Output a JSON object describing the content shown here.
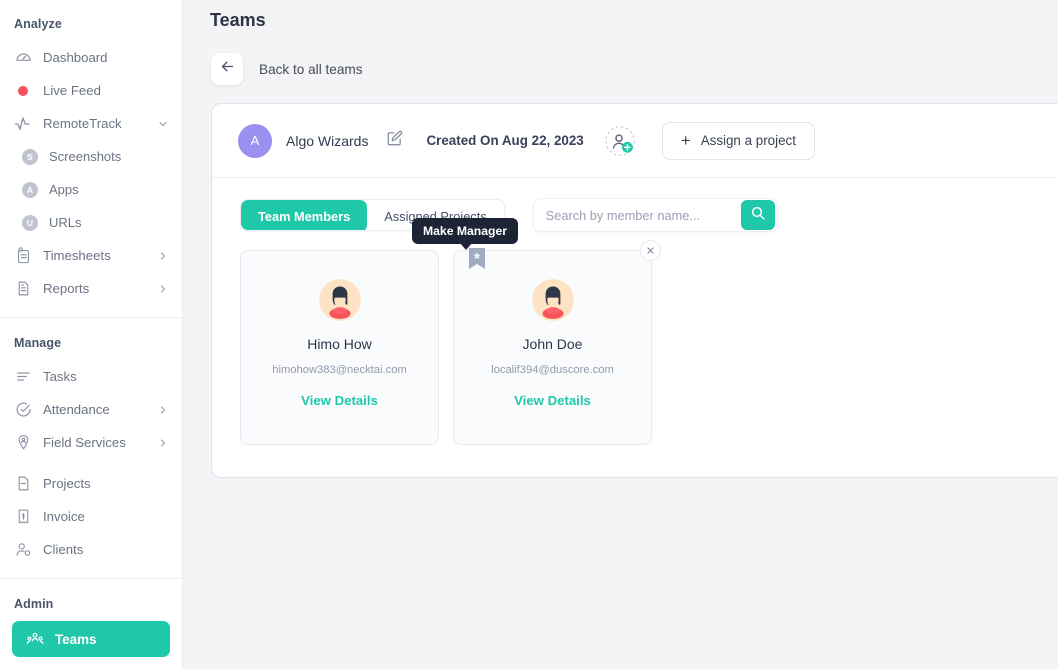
{
  "sidebar": {
    "sections": [
      {
        "label": "Analyze",
        "items": [
          {
            "label": "Dashboard",
            "icon": "gauge-icon",
            "chevron": false
          },
          {
            "label": "Live Feed",
            "icon": "live-dot-icon",
            "chevron": false
          },
          {
            "label": "RemoteTrack",
            "icon": "activity-icon",
            "chevron": true
          },
          {
            "label": "Screenshots",
            "icon": "s-circle-icon",
            "sub": true
          },
          {
            "label": "Apps",
            "icon": "a-circle-icon",
            "sub": true
          },
          {
            "label": "URLs",
            "icon": "u-circle-icon",
            "sub": true
          },
          {
            "label": "Timesheets",
            "icon": "timesheet-icon",
            "chevron": true
          },
          {
            "label": "Reports",
            "icon": "report-icon",
            "chevron": true
          }
        ]
      },
      {
        "label": "Manage",
        "items": [
          {
            "label": "Tasks",
            "icon": "tasks-icon",
            "chevron": false
          },
          {
            "label": "Attendance",
            "icon": "attendance-icon",
            "chevron": true
          },
          {
            "label": "Field Services",
            "icon": "location-person-icon",
            "chevron": true
          },
          {
            "label": "Projects",
            "icon": "projects-icon",
            "chevron": false
          },
          {
            "label": "Invoice",
            "icon": "invoice-icon",
            "chevron": false
          },
          {
            "label": "Clients",
            "icon": "clients-icon",
            "chevron": false
          }
        ]
      },
      {
        "label": "Admin",
        "items": [
          {
            "label": "Teams",
            "icon": "teams-icon",
            "active": true
          }
        ]
      }
    ]
  },
  "header": {
    "page_title": "Teams",
    "back_label": "Back to all teams",
    "back_icon": "arrow-left-icon"
  },
  "team": {
    "avatar_letter": "A",
    "name": "Algo Wizards",
    "edit_icon": "edit-pencil-icon",
    "created_on": "Created On Aug 22, 2023",
    "add_member_icon": "add-member-icon",
    "assign_button_label": "Assign a project",
    "assign_button_icon": "plus-icon"
  },
  "tabs": [
    {
      "label": "Team Members",
      "active": true
    },
    {
      "label": "Assigned Projects",
      "active": false
    }
  ],
  "search": {
    "placeholder": "Search by member name...",
    "value": "",
    "icon": "search-icon"
  },
  "tooltip": {
    "text": "Make Manager"
  },
  "members": [
    {
      "name": "Himo How",
      "email": "himohow383@necktai.com",
      "link_label": "View Details",
      "avatar_icon": "person-avatar-icon",
      "has_bookmark": false,
      "has_close": false
    },
    {
      "name": "John Doe",
      "email": "localif394@duscore.com",
      "link_label": "View Details",
      "avatar_icon": "person-avatar-icon",
      "has_bookmark": true,
      "bookmark_icon": "bookmark-star-icon",
      "has_close": true,
      "close_icon": "close-icon"
    }
  ],
  "colors": {
    "accent": "#1fc8a9",
    "team_avatar": "#9b8ff0",
    "live_dot": "#f4525b",
    "tooltip_bg": "#1d2436",
    "sidebar_text": "#6b7384",
    "page_bg": "#f4f4f6"
  }
}
